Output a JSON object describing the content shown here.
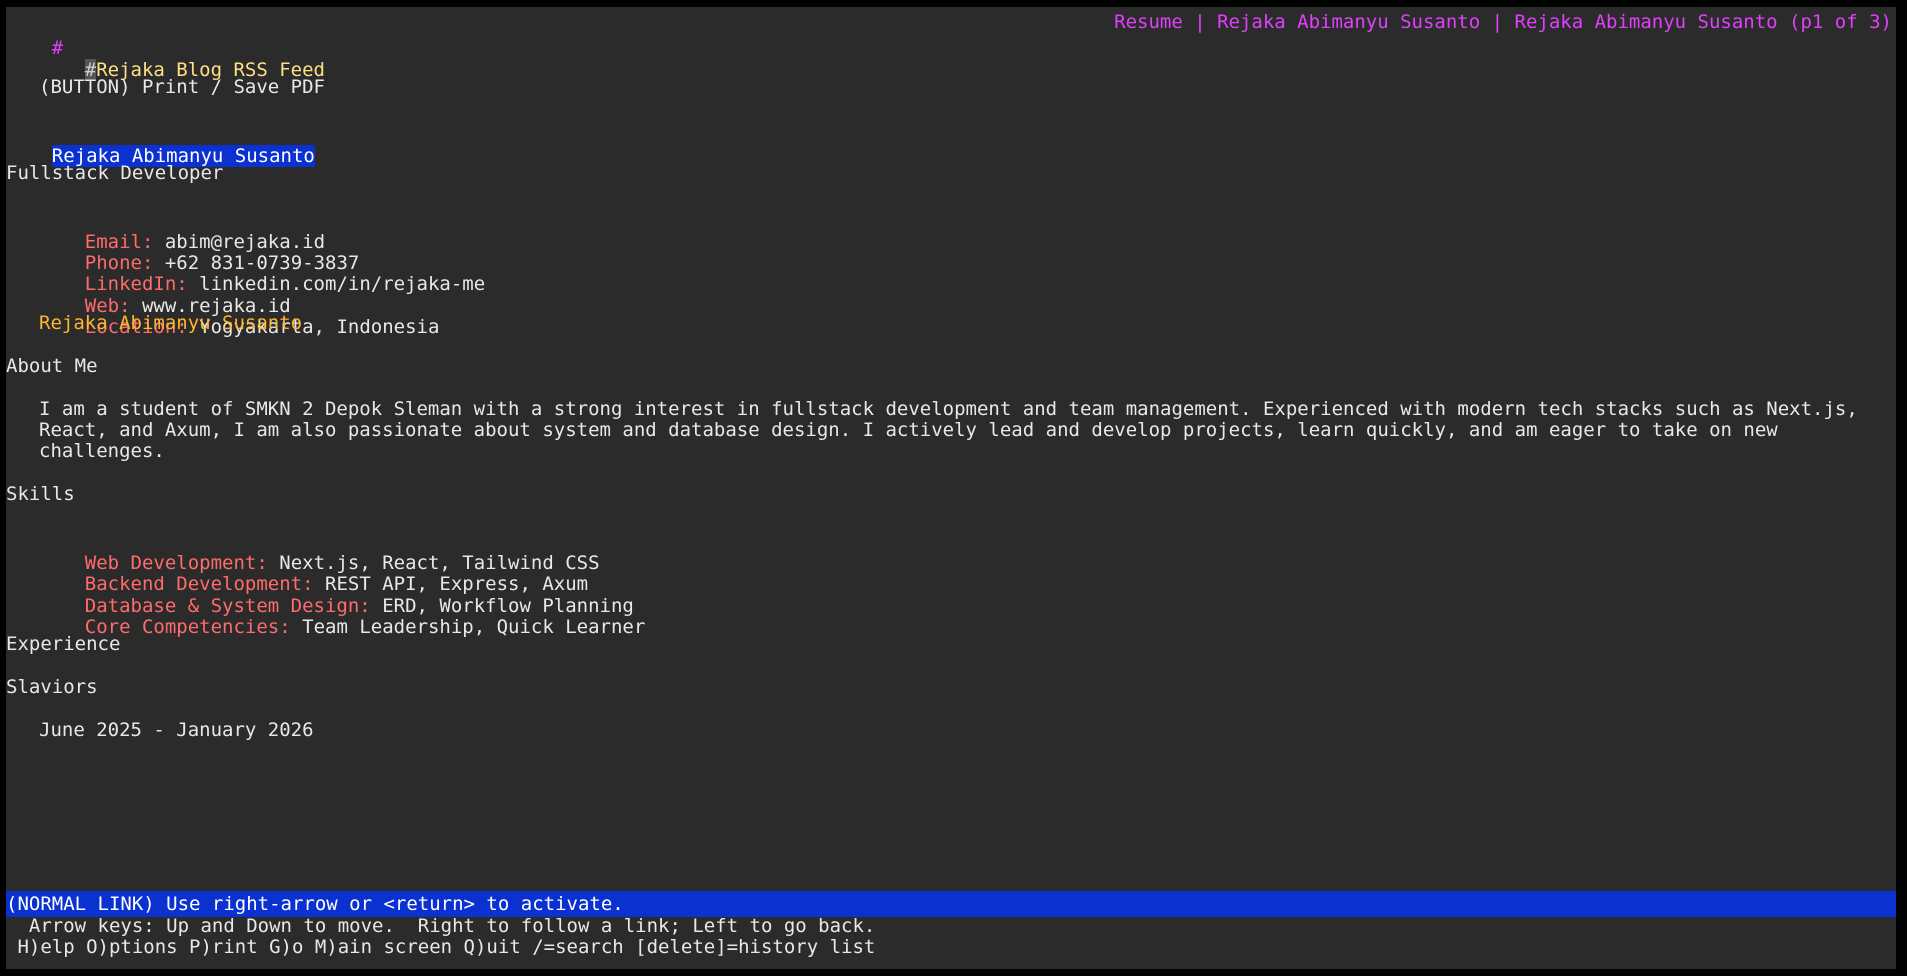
{
  "header": {
    "hash_marker": "#",
    "title": "Resume | Rejaka Abimanyu Susanto | Rejaka Abimanyu Susanto (p1 of 3)"
  },
  "links": {
    "rss_hash": "#",
    "rss_label": "Rejaka Blog RSS Feed",
    "print_button": "(BUTTON) Print / Save PDF",
    "name_link": "Rejaka Abimanyu Susanto",
    "footer_name_link": "Rejaka Abimanyu Susanto"
  },
  "profile": {
    "role": "Fullstack Developer",
    "contact": [
      {
        "label": "Email:",
        "value": "abim@rejaka.id"
      },
      {
        "label": "Phone:",
        "value": "+62 831-0739-3837"
      },
      {
        "label": "LinkedIn:",
        "value": "linkedin.com/in/rejaka-me"
      },
      {
        "label": "Web:",
        "value": "www.rejaka.id"
      },
      {
        "label": "Location:",
        "value": "Yogyakarta, Indonesia"
      }
    ]
  },
  "about": {
    "heading": "About Me",
    "lines": [
      "I am a student of SMKN 2 Depok Sleman with a strong interest in fullstack development and team management. Experienced with modern tech stacks such as Next.js,",
      "React, and Axum, I am also passionate about system and database design. I actively lead and develop projects, learn quickly, and am eager to take on new",
      "challenges."
    ]
  },
  "skills": {
    "heading": "Skills",
    "items": [
      {
        "label": "Web Development:",
        "value": "Next.js, React, Tailwind CSS"
      },
      {
        "label": "Backend Development:",
        "value": "REST API, Express, Axum"
      },
      {
        "label": "Database & System Design:",
        "value": "ERD, Workflow Planning"
      },
      {
        "label": "Core Competencies:",
        "value": "Team Leadership, Quick Learner"
      }
    ]
  },
  "experience": {
    "heading": "Experience",
    "company": "Slaviors",
    "period": "June 2025 - January 2026"
  },
  "status": {
    "link_hint": "(NORMAL LINK) Use right-arrow or <return> to activate.",
    "keys_hint": "  Arrow keys: Up and Down to move.  Right to follow a link; Left to go back.",
    "commands": " H)elp O)ptions P)rint G)o M)ain screen Q)uit /=search [delete]=history list"
  },
  "colors": {
    "background": "#2b2b2b",
    "highlight": "#0b31d1",
    "label_red": "#ff6b6b",
    "link_orange": "#ffb52e",
    "title_magenta": "#e040fb"
  }
}
